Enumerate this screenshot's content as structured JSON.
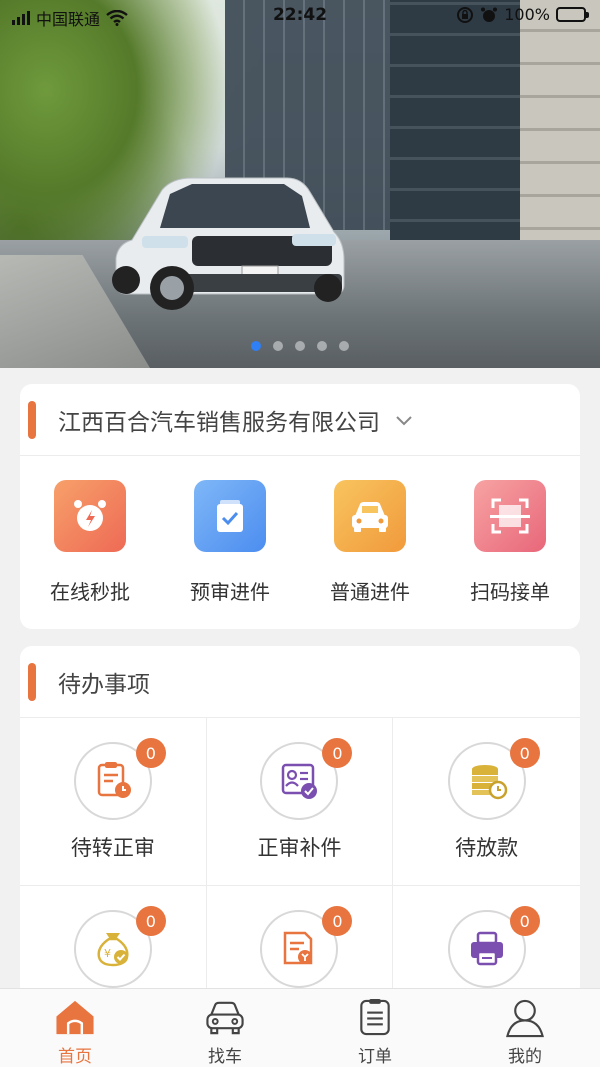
{
  "status_bar": {
    "carrier": "中国联通",
    "time": "22:42",
    "battery": "100%"
  },
  "banner": {
    "slide_count": 5,
    "active_slide": 1
  },
  "company": {
    "name": "江西百合汽车销售服务有限公司"
  },
  "quick_actions": [
    {
      "label": "在线秒批",
      "icon": "alarm-clock-icon",
      "color_from": "#f7a06a",
      "color_to": "#ee6a55"
    },
    {
      "label": "预审进件",
      "icon": "clipboard-check-icon",
      "color_from": "#7fb7f7",
      "color_to": "#4c8df0"
    },
    {
      "label": "普通进件",
      "icon": "car-icon",
      "color_from": "#f8c45e",
      "color_to": "#f19a3c"
    },
    {
      "label": "扫码接单",
      "icon": "scan-icon",
      "color_from": "#f7a3a3",
      "color_to": "#e8677a"
    }
  ],
  "todo": {
    "title": "待办事项",
    "items": [
      {
        "label": "待转正审",
        "count": "0",
        "icon": "document-clock-icon"
      },
      {
        "label": "正审补件",
        "count": "0",
        "icon": "id-card-check-icon"
      },
      {
        "label": "待放款",
        "count": "0",
        "icon": "coins-clock-icon"
      },
      {
        "label": "",
        "count": "0",
        "icon": "money-bag-check-icon"
      },
      {
        "label": "",
        "count": "0",
        "icon": "document-money-icon"
      },
      {
        "label": "",
        "count": "0",
        "icon": "printer-icon"
      }
    ]
  },
  "tabbar": {
    "tabs": [
      {
        "label": "首页",
        "icon": "home-icon",
        "active": true
      },
      {
        "label": "找车",
        "icon": "car-front-icon",
        "active": false
      },
      {
        "label": "订单",
        "icon": "order-list-icon",
        "active": false
      },
      {
        "label": "我的",
        "icon": "user-icon",
        "active": false
      }
    ]
  },
  "colors": {
    "accent": "#e8743f",
    "dot_active": "#2f7ff5",
    "battery": "#4cd964"
  }
}
